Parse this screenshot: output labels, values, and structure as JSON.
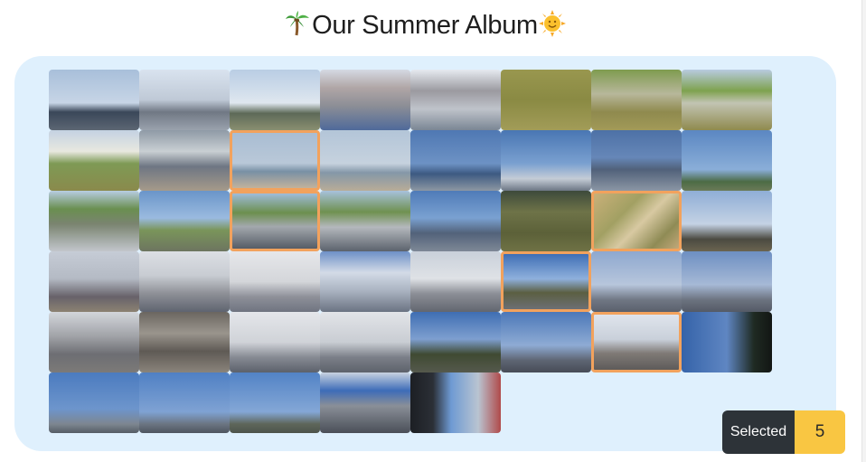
{
  "album": {
    "title": "Our Summer Album",
    "title_prefix_icon": "palm-tree-emoji",
    "title_suffix_icon": "sun-face-emoji"
  },
  "selection": {
    "label": "Selected",
    "count": "5"
  },
  "colors": {
    "panel_background": "#dff0fd",
    "selected_border": "#f2a25d",
    "count_badge": "#f9c642",
    "label_badge": "#2d3338"
  },
  "photos": [
    {
      "scene": "coastal-road-sky",
      "selected": false,
      "bg": "linear-gradient(to bottom,#a8bfda 0%,#c7d5e6 55%,#3a4759 70%,#5c6673 100%)"
    },
    {
      "scene": "observation-tower-road",
      "selected": false,
      "bg": "linear-gradient(to bottom,#d9e3ef 0%,#bfc9d6 50%,#707884 70%,#9aa2ad 100%)"
    },
    {
      "scene": "seawall-horizon",
      "selected": false,
      "bg": "linear-gradient(to bottom,#b9cde4 0%,#dfe7ef 55%,#5d6a58 72%,#8a8f70 100%)"
    },
    {
      "scene": "shopfront-building",
      "selected": false,
      "bg": "linear-gradient(to bottom,#d5d9e3 0%,#b0a6a6 30%,#8c8e96 60%,#4f6a9a 100%)"
    },
    {
      "scene": "shopfront-building-2",
      "selected": false,
      "bg": "linear-gradient(to bottom,#e6eaf0 0%,#9b9aa0 35%,#bfc3ca 65%,#7a8694 100%)"
    },
    {
      "scene": "grass-field",
      "selected": false,
      "bg": "linear-gradient(to bottom,#99974f 0%,#8a8a43 50%,#a29c58 100%)"
    },
    {
      "scene": "grass-slope-wall",
      "selected": false,
      "bg": "linear-gradient(to bottom,#7f9b4f 0%,#b7b79b 40%,#8f8a4e 70%,#a29a58 100%)"
    },
    {
      "scene": "grass-slope-wall-2",
      "selected": false,
      "bg": "linear-gradient(to bottom,#b8cbe0 0%,#7ea24e 35%,#c2c4b3 55%,#8f8a4e 100%)"
    },
    {
      "scene": "dunes-person",
      "selected": false,
      "bg": "linear-gradient(to bottom,#c4d2e2 0%,#e8e8e0 35%,#7e9a55 55%,#8a8a4c 100%)"
    },
    {
      "scene": "surf-beach-truck",
      "selected": false,
      "bg": "linear-gradient(to bottom,#8f9aa6 0%,#c9cfd3 35%,#6e7683 60%,#a59a8a 100%)"
    },
    {
      "scene": "calm-sea-beach",
      "selected": true,
      "bg": "linear-gradient(to bottom,#a9bdd3 0%,#b9c8d8 55%,#7890a5 70%,#c2b29c 100%)"
    },
    {
      "scene": "calm-sea-beach-2",
      "selected": false,
      "bg": "linear-gradient(to bottom,#b3c5d8 0%,#c6d2de 55%,#8497a8 70%,#b8ac98 100%)"
    },
    {
      "scene": "harbor-horizon",
      "selected": false,
      "bg": "linear-gradient(to bottom,#4f78b3 0%,#6d92c4 55%,#3d5a82 72%,#8c97a2 100%)"
    },
    {
      "scene": "flag-pole-tower",
      "selected": false,
      "bg": "linear-gradient(to bottom,#4976b3 0%,#7aa0d0 55%,#c4ccd6 80%,#6c7684 100%)"
    },
    {
      "scene": "fishing-boats",
      "selected": false,
      "bg": "linear-gradient(to bottom,#4d71a6 0%,#6687b8 45%,#51617a 65%,#8b96a4 100%)"
    },
    {
      "scene": "flag-pole-field",
      "selected": false,
      "bg": "linear-gradient(to bottom,#5b87c2 0%,#8aaed8 65%,#4c6b45 85%,#6b7a58 100%)"
    },
    {
      "scene": "parking-lot-sky",
      "selected": false,
      "bg": "linear-gradient(to bottom,#b8cde2 0%,#6a8f50 30%,#7a8470 55%,#c2c6cc 100%)"
    },
    {
      "scene": "lookout-field",
      "selected": false,
      "bg": "linear-gradient(to bottom,#6a95c9 0%,#9abadf 45%,#7a955a 65%,#6d7560 100%)"
    },
    {
      "scene": "parking-cars",
      "selected": true,
      "bg": "linear-gradient(to bottom,#9fbcd9 0%,#6c8f4e 35%,#a3a8ad 60%,#555c66 100%)"
    },
    {
      "scene": "parking-cars-2",
      "selected": false,
      "bg": "linear-gradient(to bottom,#a7c1dc 0%,#6f9150 35%,#b4b8bd 60%,#5b626c 100%)"
    },
    {
      "scene": "harbor-cars",
      "selected": false,
      "bg": "linear-gradient(to bottom,#4f7bb8 0%,#7aa1d1 45%,#52627a 70%,#7e8896 100%)"
    },
    {
      "scene": "park-bench-grass",
      "selected": false,
      "bg": "linear-gradient(to bottom,#3d4a3b 0%,#6e7348 35%,#5c6139 70%,#6f7245 100%)"
    },
    {
      "scene": "dry-grass-closeup",
      "selected": true,
      "bg": "linear-gradient(135deg,#c9b079 0%,#a2a063 35%,#d8c9a2 55%,#8f8b55 80%,#c2a87a 100%)"
    },
    {
      "scene": "bare-trees-sky",
      "selected": false,
      "bg": "linear-gradient(to bottom,#8faed6 0%,#c4d2e4 55%,#4b4a41 80%,#6a6450 100%)"
    },
    {
      "scene": "hilltop-tree-city",
      "selected": false,
      "bg": "linear-gradient(to bottom,#c6ccd6 0%,#b4bac4 45%,#67626a 75%,#8c8272 100%)"
    },
    {
      "scene": "hazy-city-railing",
      "selected": false,
      "bg": "linear-gradient(to bottom,#dcdfe4 0%,#c8ccd2 40%,#8d8f96 70%,#5f6470 100%)"
    },
    {
      "scene": "hazy-city-view",
      "selected": false,
      "bg": "linear-gradient(to bottom,#e6e7ea 0%,#d4d6da 50%,#8e9099 75%,#6f7480 100%)"
    },
    {
      "scene": "clouds-city",
      "selected": false,
      "bg": "linear-gradient(to bottom,#6d90c7 0%,#d3dbe7 35%,#aab3c1 65%,#6b7382 100%)"
    },
    {
      "scene": "city-skyline",
      "selected": false,
      "bg": "linear-gradient(to bottom,#c9d0da 0%,#dfe2e6 45%,#8b8e96 70%,#62666f 100%)"
    },
    {
      "scene": "hill-tree-blue-sky",
      "selected": true,
      "bg": "linear-gradient(to bottom,#3f6fb5 0%,#8fb0dc 45%,#5b5f42 70%,#6c6f74 100%)"
    },
    {
      "scene": "city-panorama",
      "selected": false,
      "bg": "linear-gradient(to bottom,#8ea8cf 0%,#b7c6dc 55%,#707784 80%,#5a606c 100%)"
    },
    {
      "scene": "city-panorama-2",
      "selected": false,
      "bg": "linear-gradient(to bottom,#6d8fc2 0%,#a6b9d6 55%,#6c7380 80%,#545a66 100%)"
    },
    {
      "scene": "dense-city",
      "selected": false,
      "bg": "linear-gradient(to bottom,#d3d6db 0%,#a1a3a8 40%,#6d6e73 70%,#7c7a78 100%)"
    },
    {
      "scene": "rooftops-closeup",
      "selected": false,
      "bg": "linear-gradient(to bottom,#6b6660 0%,#9a958d 35%,#5f5a55 65%,#8a847b 100%)"
    },
    {
      "scene": "hazy-skyline",
      "selected": false,
      "bg": "linear-gradient(to bottom,#e4e6ea 0%,#d0d3d8 50%,#868a93 75%,#5c616b 100%)"
    },
    {
      "scene": "branches-city",
      "selected": false,
      "bg": "linear-gradient(to bottom,#e2e4e8 0%,#c9cdd3 50%,#7b7f88 75%,#5d626b 100%)"
    },
    {
      "scene": "tree-city-blue",
      "selected": false,
      "bg": "linear-gradient(to bottom,#3f6eb3 0%,#7e9fcf 45%,#3f4a32 70%,#55594d 100%)"
    },
    {
      "scene": "wide-city-blue",
      "selected": false,
      "bg": "linear-gradient(to bottom,#4c78b8 0%,#8eabd4 55%,#5e6573 80%,#474c57 100%)"
    },
    {
      "scene": "branch-over-city",
      "selected": true,
      "bg": "linear-gradient(to bottom,#dfe4ec 0%,#c9d0da 45%,#7f7a76 70%,#5e5b5a 100%)"
    },
    {
      "scene": "street-tree-dark",
      "selected": false,
      "bg": "linear-gradient(to right,#3563a9 0%,#5f86c2 50%,#1f2a22 80%,#121614 100%)"
    },
    {
      "scene": "street-lamps-sky",
      "selected": false,
      "bg": "linear-gradient(to bottom,#4b7bbf 0%,#6d95cc 60%,#7d8690 85%,#555d66 100%)"
    },
    {
      "scene": "road-sign-sky",
      "selected": false,
      "bg": "linear-gradient(to bottom,#4f80c4 0%,#7fa2d3 65%,#6b7582 85%,#4e5560 100%)"
    },
    {
      "scene": "road-trees-sky",
      "selected": false,
      "bg": "linear-gradient(to bottom,#5283c6 0%,#84a7d6 65%,#5e665a 85%,#4d544c 100%)"
    },
    {
      "scene": "highway-traffic",
      "selected": false,
      "bg": "linear-gradient(to bottom,#c8d2e0 0%,#3d6cb8 30%,#8a8f98 55%,#4a4f58 100%)"
    },
    {
      "scene": "car-interior-street",
      "selected": false,
      "bg": "linear-gradient(to right,#1c1f24 0%,#2b2f36 25%,#6e9ad3 45%,#b9c4d1 75%,#b04a4a 100%)"
    }
  ]
}
